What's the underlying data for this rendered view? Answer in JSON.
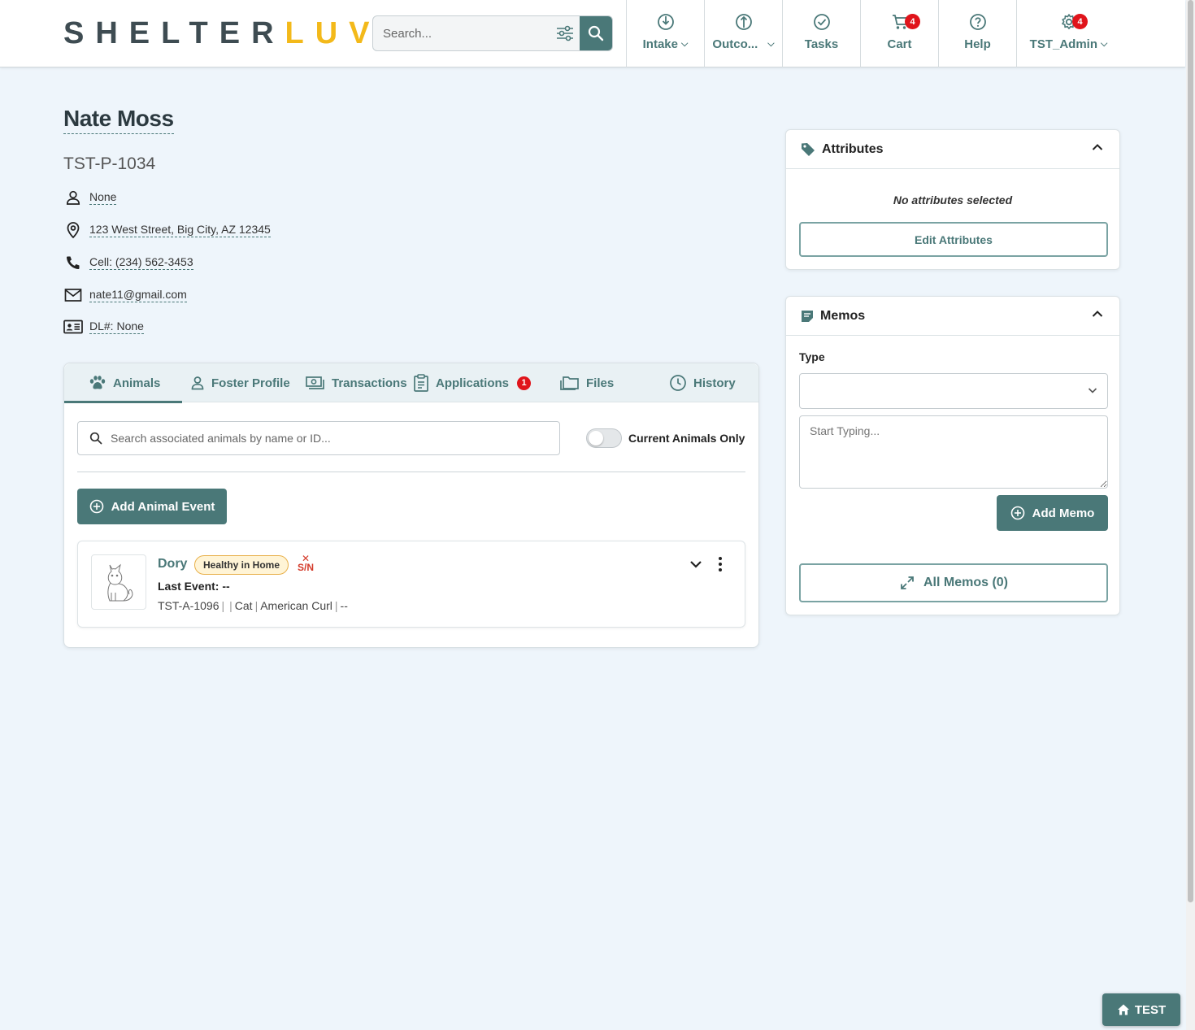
{
  "header": {
    "logo_part1": "SHELTER",
    "logo_part2": "LUV",
    "search_placeholder": "Search...",
    "nav": [
      {
        "label": "Intake",
        "icon": "intake-icon"
      },
      {
        "label": "Outco...",
        "icon": "outcome-icon"
      },
      {
        "label": "Tasks",
        "icon": "check-circle-icon"
      },
      {
        "label": "Cart",
        "icon": "cart-icon",
        "badge": "4"
      },
      {
        "label": "Help",
        "icon": "help-icon"
      },
      {
        "label": "TST_Admin",
        "icon": "gear-icon",
        "badge": "4"
      }
    ]
  },
  "person": {
    "name": "Nate Moss",
    "id": "TST-P-1034",
    "gender": "None",
    "address": "123 West Street, Big City, AZ 12345",
    "phone": "Cell: (234) 562-3453",
    "email": "nate11@gmail.com",
    "dl": "DL#: None"
  },
  "tabs": [
    {
      "label": "Animals"
    },
    {
      "label": "Foster Profile"
    },
    {
      "label": "Transactions"
    },
    {
      "label": "Applications",
      "badge": "1"
    },
    {
      "label": "Files"
    },
    {
      "label": "History"
    }
  ],
  "animals_panel": {
    "search_placeholder": "Search associated animals by name or ID...",
    "toggle_label": "Current Animals Only",
    "add_button": "Add Animal Event",
    "animal": {
      "name": "Dory",
      "status": "Healthy in Home",
      "sn_label": "S/N",
      "last_event": "Last Event: --",
      "id": "TST-A-1096",
      "species": "Cat",
      "breed": "American Curl",
      "extra": "--"
    }
  },
  "attributes": {
    "title": "Attributes",
    "empty_text": "No attributes selected",
    "edit_button": "Edit Attributes"
  },
  "memos": {
    "title": "Memos",
    "type_label": "Type",
    "textarea_placeholder": "Start Typing...",
    "add_button": "Add Memo",
    "all_button": "All Memos (0)"
  },
  "footer": {
    "test_button": "TEST"
  },
  "colors": {
    "teal": "#4a7878",
    "logo_yellow": "#f3b91a",
    "badge_red": "#e0141b",
    "page_bg": "#eef5fb"
  }
}
